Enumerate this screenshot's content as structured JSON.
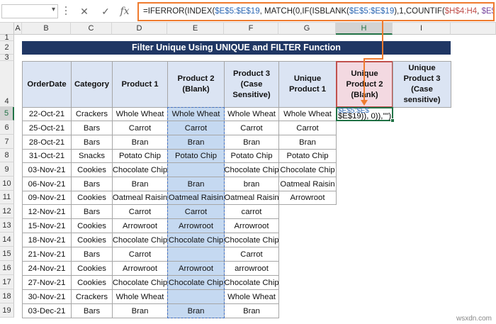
{
  "formula_bar": {
    "name_box": "",
    "cancel_icon": "✕",
    "enter_icon": "✓",
    "fx_label": "fx",
    "parts": [
      {
        "t": "=IFERROR(INDEX(",
        "c": "n"
      },
      {
        "t": "$E$5:$E$19",
        "c": "b"
      },
      {
        "t": ", MATCH(0,IF(ISBLANK(",
        "c": "n"
      },
      {
        "t": "$E$5:$E$19",
        "c": "b"
      },
      {
        "t": "),1,COUNTIF(",
        "c": "n"
      },
      {
        "t": "$H$4:H4",
        "c": "r"
      },
      {
        "t": ", ",
        "c": "n"
      },
      {
        "t": "$E$5:$E$19",
        "c": "p"
      },
      {
        "t": ")), 0)),\"\")",
        "c": "n"
      }
    ]
  },
  "columns": [
    "A",
    "B",
    "C",
    "D",
    "E",
    "F",
    "G",
    "H",
    "I"
  ],
  "rows": [
    "1",
    "2",
    "3",
    "4",
    "5",
    "6",
    "7",
    "8",
    "9",
    "10",
    "11",
    "12",
    "13",
    "14",
    "15",
    "16",
    "17",
    "18",
    "19"
  ],
  "title": "Filter Unique Using UNIQUE and FILTER Function",
  "headers": {
    "B": "OrderDate",
    "C": "Category",
    "D": "Product 1",
    "E": "Product 2 (Blank)",
    "F": "Product 3 (Case Sensitive)",
    "G": "Unique Product 1",
    "H": "Unique Product 2 (Blank)",
    "I": "Unique Product 3 (Case sensitive)"
  },
  "table": [
    [
      "22-Oct-21",
      "Crackers",
      "Whole Wheat",
      "Whole Wheat",
      "Whole Wheat",
      "Whole Wheat"
    ],
    [
      "25-Oct-21",
      "Bars",
      "Carrot",
      "Carrot",
      "Carrot",
      "Carrot"
    ],
    [
      "28-Oct-21",
      "Bars",
      "Bran",
      "Bran",
      "Bran",
      "Bran"
    ],
    [
      "31-Oct-21",
      "Snacks",
      "Potato Chip",
      "Potato Chip",
      "Potato Chip",
      "Potato Chip"
    ],
    [
      "03-Nov-21",
      "Cookies",
      "Chocolate Chip",
      "",
      "Chocolate Chip",
      "Chocolate Chip"
    ],
    [
      "06-Nov-21",
      "Bars",
      "Bran",
      "Bran",
      "bran",
      "Oatmeal Raisin"
    ],
    [
      "09-Nov-21",
      "Cookies",
      "Oatmeal Raisin",
      "Oatmeal Raisin",
      "Oatmeal Raisin",
      "Arrowroot"
    ],
    [
      "12-Nov-21",
      "Bars",
      "Carrot",
      "Carrot",
      "carrot",
      ""
    ],
    [
      "15-Nov-21",
      "Cookies",
      "Arrowroot",
      "Arrowroot",
      "Arrowroot",
      ""
    ],
    [
      "18-Nov-21",
      "Cookies",
      "Chocolate Chip",
      "Chocolate Chip",
      "Chocolate Chip",
      ""
    ],
    [
      "21-Nov-21",
      "Bars",
      "Carrot",
      "",
      "Carrot",
      ""
    ],
    [
      "24-Nov-21",
      "Cookies",
      "Arrowroot",
      "Arrowroot",
      "arrowroot",
      ""
    ],
    [
      "27-Nov-21",
      "Cookies",
      "Chocolate Chip",
      "Chocolate Chip",
      "Chocolate Chip",
      ""
    ],
    [
      "30-Nov-21",
      "Crackers",
      "Whole Wheat",
      "",
      "Whole Wheat",
      ""
    ],
    [
      "03-Dec-21",
      "Bars",
      "Bran",
      "Bran",
      "Bran",
      ""
    ]
  ],
  "active_cell_overflow": {
    "line1": "$E$5:$E$",
    "line2": "$E$19)), 0)),\"\")"
  },
  "watermark": "wsxdn.com",
  "colors": {
    "title_bg": "#203764",
    "header_bg": "#dbe4f3",
    "highlight": "#c5d9f1",
    "accent": "#ef7b2e"
  }
}
